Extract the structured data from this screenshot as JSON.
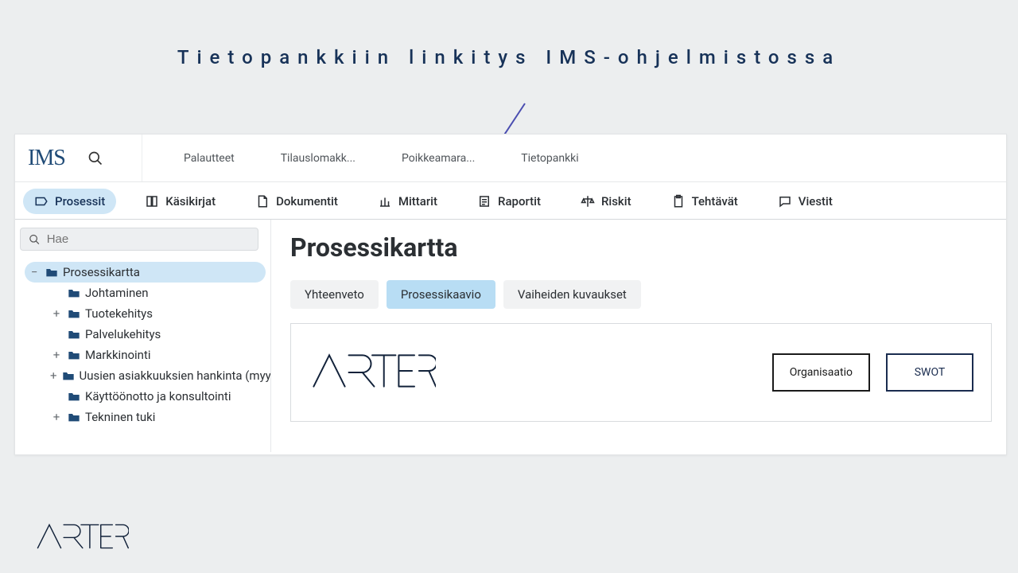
{
  "slide": {
    "title": "Tietopankkiin linkitys IMS-ohjelmistossa"
  },
  "logo": {
    "brand": "IMS"
  },
  "topnav": {
    "items": [
      {
        "label": "Palautteet"
      },
      {
        "label": "Tilauslomakk..."
      },
      {
        "label": "Poikkeamara..."
      },
      {
        "label": "Tietopankki"
      }
    ]
  },
  "tabs": [
    {
      "label": "Prosessit",
      "active": true,
      "icon": "tag"
    },
    {
      "label": "Käsikirjat",
      "icon": "book"
    },
    {
      "label": "Dokumentit",
      "icon": "doc"
    },
    {
      "label": "Mittarit",
      "icon": "chart"
    },
    {
      "label": "Raportit",
      "icon": "report"
    },
    {
      "label": "Riskit",
      "icon": "scale"
    },
    {
      "label": "Tehtävät",
      "icon": "clipboard"
    },
    {
      "label": "Viestit",
      "icon": "message"
    }
  ],
  "sidebar": {
    "search_placeholder": "Hae",
    "root": {
      "label": "Prosessikartta",
      "children": [
        {
          "expander": "",
          "label": "Johtaminen"
        },
        {
          "expander": "+",
          "label": "Tuotekehitys"
        },
        {
          "expander": "",
          "label": "Palvelukehitys"
        },
        {
          "expander": "+",
          "label": "Markkinointi"
        },
        {
          "expander": "+",
          "label": "Uusien asiakkuuksien hankinta (myynti)"
        },
        {
          "expander": "",
          "label": "Käyttöönotto ja konsultointi"
        },
        {
          "expander": "+",
          "label": "Tekninen tuki"
        }
      ]
    }
  },
  "main": {
    "title": "Prosessikartta",
    "subtabs": [
      {
        "label": "Yhteenveto"
      },
      {
        "label": "Prosessikaavio",
        "active": true
      },
      {
        "label": "Vaiheiden kuvaukset"
      }
    ],
    "canvas": {
      "logo_text": "ARTER",
      "nodes": [
        {
          "label": "Organisaatio",
          "style": "black"
        },
        {
          "label": "SWOT",
          "style": "navy"
        }
      ]
    }
  },
  "footer": {
    "logo_text": "ARTER"
  }
}
